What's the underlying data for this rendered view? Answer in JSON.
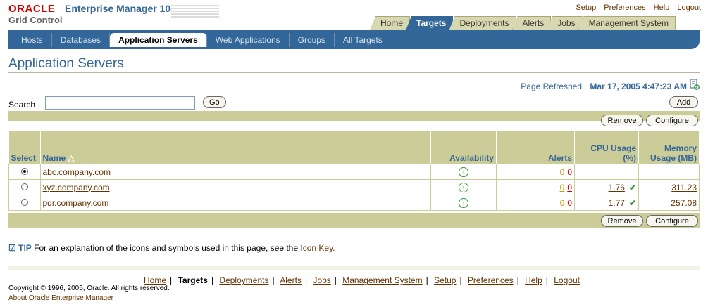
{
  "header": {
    "logo_oracle": "ORACLE",
    "logo_em": "Enterprise Manager 10g",
    "logo_gc": "Grid Control",
    "global_links": [
      "Setup",
      "Preferences",
      "Help",
      "Logout"
    ]
  },
  "tabs": [
    "Home",
    "Targets",
    "Deployments",
    "Alerts",
    "Jobs",
    "Management System"
  ],
  "active_tab": "Targets",
  "subnav": [
    "Hosts",
    "Databases",
    "Application Servers",
    "Web Applications",
    "Groups",
    "All Targets"
  ],
  "active_subnav": "Application Servers",
  "page_title": "Application Servers",
  "refresh": {
    "label": "Page Refreshed",
    "time": "Mar 17, 2005 4:47:23 AM"
  },
  "search": {
    "label": "Search",
    "value": "",
    "go": "Go"
  },
  "buttons": {
    "add": "Add",
    "remove": "Remove",
    "configure": "Configure"
  },
  "table": {
    "headers": {
      "select": "Select",
      "name": "Name",
      "availability": "Availability",
      "alerts": "Alerts",
      "cpu": "CPU Usage (%)",
      "memory": "Memory Usage (MB)"
    },
    "rows": [
      {
        "name": "abc.company.com",
        "alerts_warn": "0",
        "alerts_crit": "0",
        "cpu": "",
        "memory": ""
      },
      {
        "name": "xyz.company.com",
        "alerts_warn": "0",
        "alerts_crit": "0",
        "cpu": "1.76",
        "memory": "311.23"
      },
      {
        "name": "pqr.company.com",
        "alerts_warn": "0",
        "alerts_crit": "0",
        "cpu": "1.77",
        "memory": "257.08"
      }
    ]
  },
  "tip": {
    "label": "TIP",
    "text": "For an explanation of the icons and symbols used in this page, see the",
    "link": "Icon Key."
  },
  "footer": {
    "links": [
      "Home",
      "Targets",
      "Deployments",
      "Alerts",
      "Jobs",
      "Management System",
      "Setup",
      "Preferences",
      "Help",
      "Logout"
    ],
    "copyright": "Copyright © 1996, 2005, Oracle. All rights reserved.",
    "about": "About Oracle Enterprise Manager"
  },
  "colors": {
    "brand_blue": "#336699",
    "olive": "#cccc99",
    "link": "#663300",
    "oracle_red": "#cc0000"
  }
}
